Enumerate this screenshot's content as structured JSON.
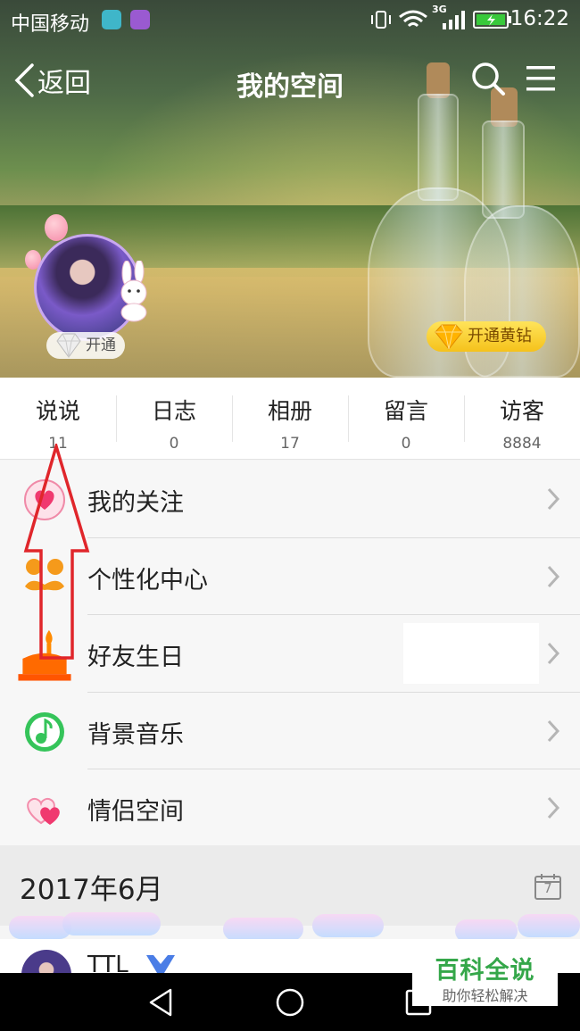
{
  "status_bar": {
    "carrier": "中国移动",
    "network": "3G",
    "time": "16:22"
  },
  "nav": {
    "back_label": "返回",
    "title": "我的空间"
  },
  "profile": {
    "open_badge_label": "开通",
    "yellow_diamond_label": "开通黄钻"
  },
  "stats": [
    {
      "label": "说说",
      "count": "11"
    },
    {
      "label": "日志",
      "count": "0"
    },
    {
      "label": "相册",
      "count": "17"
    },
    {
      "label": "留言",
      "count": "0"
    },
    {
      "label": "访客",
      "count": "8884"
    }
  ],
  "menu": [
    {
      "label": "我的关注",
      "icon": "heart-follow-icon"
    },
    {
      "label": "个性化中心",
      "icon": "mustache-personalize-icon"
    },
    {
      "label": "好友生日",
      "icon": "birthday-cake-icon"
    },
    {
      "label": "背景音乐",
      "icon": "music-note-icon"
    },
    {
      "label": "情侣空间",
      "icon": "couple-hearts-icon"
    }
  ],
  "timeline": {
    "month": "2017年6月",
    "calendar_day": "7"
  },
  "feed": {
    "name": "TTL"
  },
  "watermark": {
    "title": "百科全说",
    "subtitle": "助你轻松解决"
  },
  "colors": {
    "accent_green": "#35a74a",
    "yellow_diamond": "#f5c21b",
    "annotation_red": "#e0262b"
  }
}
